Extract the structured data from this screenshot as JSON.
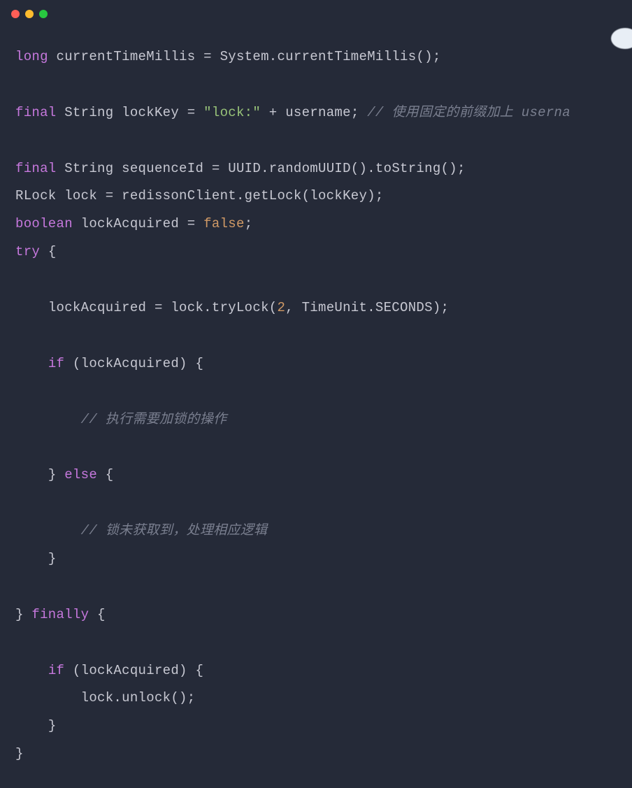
{
  "titlebar": {
    "buttons": [
      "close",
      "minimize",
      "zoom"
    ]
  },
  "code": {
    "tokens": {
      "kw_long": "long",
      "kw_final": "final",
      "kw_boolean": "boolean",
      "kw_try": "try",
      "kw_if": "if",
      "kw_else": "else",
      "kw_finally": "finally",
      "var_currentTimeMillis": "currentTimeMillis",
      "expr_systemCurrentTimeMillis": "System.currentTimeMillis()",
      "type_String1": "String",
      "var_lockKey": "lockKey",
      "str_lockPrefix": "\"lock:\"",
      "op_plus": "+",
      "var_username": "username",
      "cmt_lockKey": "// 使用固定的前缀加上 userna",
      "type_String2": "String",
      "var_sequenceId": "sequenceId",
      "expr_uuid": "UUID.randomUUID().toString()",
      "type_RLock": "RLock",
      "var_lock": "lock",
      "expr_getLock": "redissonClient.getLock(lockKey)",
      "var_lockAcquired": "lockAcquired",
      "bool_false": "false",
      "expr_tryLock_pre": "lock.tryLock(",
      "num_2": "2",
      "expr_tryLock_post": ", TimeUnit.SECONDS)",
      "cond_lockAcquired1": "(lockAcquired)",
      "cmt_doLocked": "// 执行需要加锁的操作",
      "cmt_notAcquired": "// 锁未获取到，处理相应逻辑",
      "cond_lockAcquired2": "(lockAcquired)",
      "stmt_unlock": "lock.unlock();"
    }
  }
}
